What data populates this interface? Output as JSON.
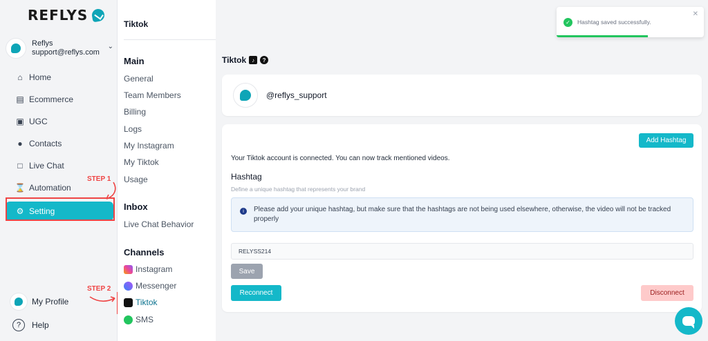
{
  "brand": {
    "name": "REFLYS",
    "accent": "#14b8c9"
  },
  "account": {
    "name": "Reflys",
    "email": "support@reflys.com"
  },
  "nav": {
    "items": [
      {
        "label": "Home",
        "icon": "home-icon"
      },
      {
        "label": "Ecommerce",
        "icon": "store-icon"
      },
      {
        "label": "UGC",
        "icon": "image-icon"
      },
      {
        "label": "Contacts",
        "icon": "users-icon"
      },
      {
        "label": "Live Chat",
        "icon": "chat-icon"
      },
      {
        "label": "Automation",
        "icon": "automation-icon"
      },
      {
        "label": "Setting",
        "icon": "gear-icon"
      }
    ],
    "bottom": {
      "profile": "My Profile",
      "help": "Help"
    }
  },
  "steps": {
    "step1": "STEP 1",
    "step2": "STEP 2"
  },
  "menu": {
    "title": "Tiktok",
    "sections": {
      "main": "Main",
      "inbox": "Inbox",
      "channels": "Channels"
    },
    "main_links": [
      "General",
      "Team Members",
      "Billing",
      "Logs",
      "My Instagram",
      "My Tiktok",
      "Usage"
    ],
    "inbox_links": [
      "Live Chat Behavior"
    ],
    "channel_links": [
      "Instagram",
      "Messenger",
      "Tiktok",
      "SMS"
    ]
  },
  "page": {
    "title": "Tiktok",
    "handle": "@reflys_support",
    "add_hashtag": "Add Hashtag",
    "connected_text": "Your Tiktok account is connected. You can now track mentioned videos.",
    "hashtag_label": "Hashtag",
    "hashtag_hint": "Define a unique hashtag that represents your brand",
    "info_text": "Please add your unique hashtag, but make sure that the hashtags are not being used elsewhere, otherwise, the video will not be tracked properly",
    "hashtag_value": "RELYSS214",
    "save": "Save",
    "reconnect": "Reconnect",
    "disconnect": "Disconnect"
  },
  "toast": {
    "message": "Hashtag saved successfully.",
    "progress": 0.62
  }
}
